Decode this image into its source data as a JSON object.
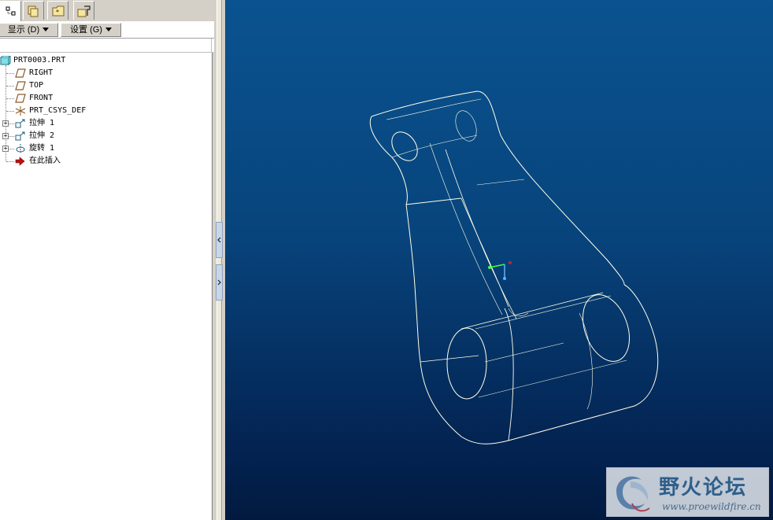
{
  "tabs": [
    {
      "name": "model-tree",
      "active": true
    },
    {
      "name": "folder-browser",
      "active": false
    },
    {
      "name": "favorites",
      "active": false
    },
    {
      "name": "connections",
      "active": false
    }
  ],
  "toolbar": {
    "show_label": "显示 (D)",
    "settings_label": "设置 (G)"
  },
  "tree": {
    "root": "PRT0003.PRT",
    "items": [
      {
        "label": "RIGHT",
        "icon": "datum-plane-icon",
        "expandable": false
      },
      {
        "label": "TOP",
        "icon": "datum-plane-icon",
        "expandable": false
      },
      {
        "label": "FRONT",
        "icon": "datum-plane-icon",
        "expandable": false
      },
      {
        "label": "PRT_CSYS_DEF",
        "icon": "csys-icon",
        "expandable": false
      },
      {
        "label": "拉伸 1",
        "icon": "extrude-icon",
        "expandable": true
      },
      {
        "label": "拉伸 2",
        "icon": "extrude-icon",
        "expandable": true
      },
      {
        "label": "旋转 1",
        "icon": "revolve-icon",
        "expandable": true
      },
      {
        "label": "在此插入",
        "icon": "insert-here-arrow-icon",
        "expandable": false
      }
    ]
  },
  "watermark": {
    "title": "野火论坛",
    "url": "www.proewildfire.cn"
  },
  "colors": {
    "viewport_top": "#0a5390",
    "viewport_bottom": "#021a40",
    "wireframe": "#ffffe8"
  }
}
